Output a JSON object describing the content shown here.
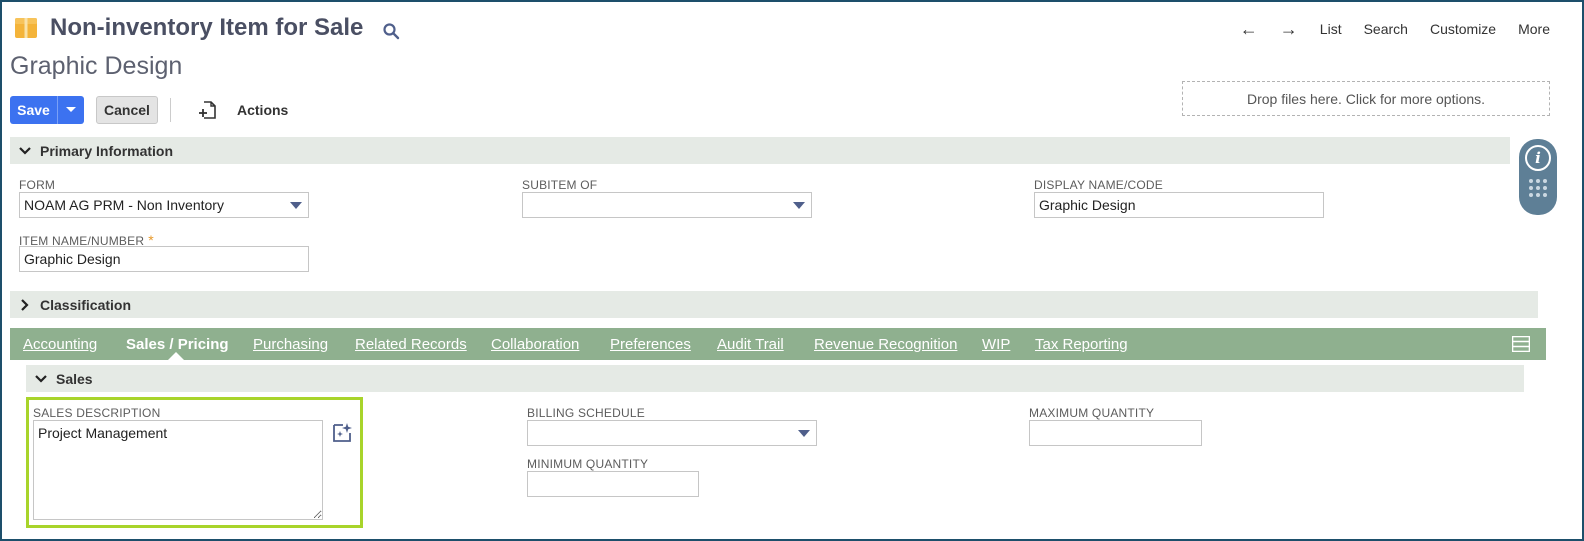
{
  "header": {
    "title": "Non-inventory Item for Sale",
    "record_name": "Graphic Design",
    "nav": {
      "list": "List",
      "search": "Search",
      "customize": "Customize",
      "more": "More"
    }
  },
  "toolbar": {
    "save_label": "Save",
    "cancel_label": "Cancel",
    "actions_label": "Actions",
    "dropzone_text": "Drop files here. Click for more options."
  },
  "primary": {
    "section_label": "Primary Information",
    "form": {
      "label": "FORM",
      "value": "NOAM AG PRM - Non Inventory"
    },
    "subitem_of": {
      "label": "SUBITEM OF",
      "value": ""
    },
    "display_name": {
      "label": "DISPLAY NAME/CODE",
      "value": "Graphic Design"
    },
    "item_name": {
      "label": "ITEM NAME/NUMBER",
      "required_mark": "*",
      "value": "Graphic Design"
    }
  },
  "classification": {
    "section_label": "Classification"
  },
  "tabs": [
    {
      "label": "Accounting"
    },
    {
      "label": "Sales / Pricing"
    },
    {
      "label": "Purchasing"
    },
    {
      "label": "Related Records"
    },
    {
      "label": "Collaboration"
    },
    {
      "label": "Preferences"
    },
    {
      "label": "Audit Trail"
    },
    {
      "label": "Revenue Recognition"
    },
    {
      "label": "WIP"
    },
    {
      "label": "Tax Reporting"
    }
  ],
  "active_tab": "Sales / Pricing",
  "sales": {
    "section_label": "Sales",
    "sales_description": {
      "label": "SALES DESCRIPTION",
      "value": "Project Management"
    },
    "billing_schedule": {
      "label": "BILLING SCHEDULE",
      "value": ""
    },
    "minimum_quantity": {
      "label": "MINIMUM QUANTITY",
      "value": ""
    },
    "maximum_quantity": {
      "label": "MAXIMUM QUANTITY",
      "value": ""
    }
  },
  "colors": {
    "title": "#4a4f63",
    "save_button": "#3c72f0",
    "tab_bar": "#8fb08f",
    "section_bar": "#e5eae5",
    "highlight": "#a8d42a",
    "frame": "#1d4f6b"
  },
  "icons": {
    "header": "item-box-icon",
    "title_search": "search-icon",
    "actions": "add-document-icon",
    "sales_ai": "ai-sparkle-icon",
    "side_info": "info-icon",
    "side_grid": "apps-grid-icon",
    "tab_menu": "menu-icon"
  }
}
